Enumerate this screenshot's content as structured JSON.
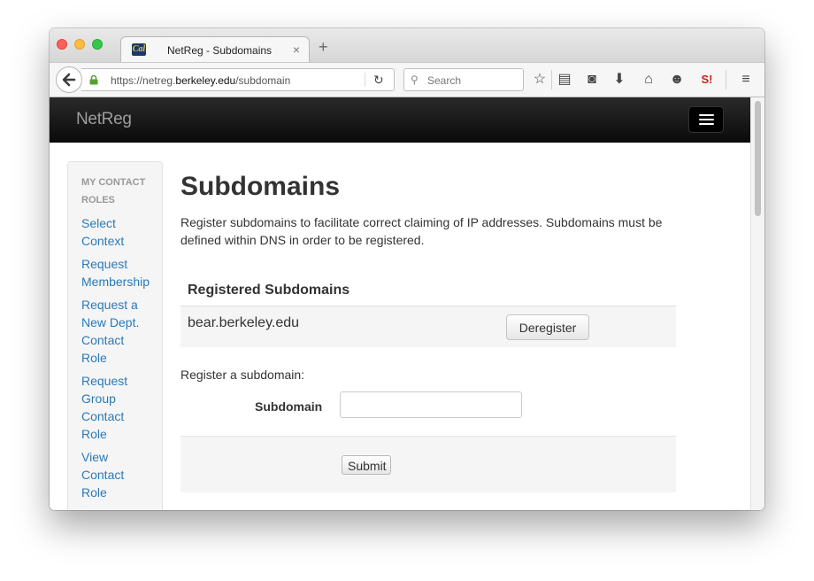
{
  "browser": {
    "tab_title": "NetReg - Subdomains",
    "tab_close": "×",
    "new_tab": "+",
    "favicon_text": "Cal",
    "url_prefix": "https://netreg.",
    "url_domain": "berkeley.edu",
    "url_path": "/subdomain",
    "search_placeholder": "Search"
  },
  "navbar": {
    "brand": "NetReg"
  },
  "sidebar": {
    "header": "MY CONTACT ROLES",
    "items": [
      {
        "label": "Select Context"
      },
      {
        "label": "Request Membership"
      },
      {
        "label": "Request a New Dept. Contact Role"
      },
      {
        "label": "Request Group Contact Role"
      },
      {
        "label": "View Contact Role"
      }
    ]
  },
  "main": {
    "title": "Subdomains",
    "intro": "Register subdomains to facilitate correct claiming of IP addresses. Subdomains must be defined within DNS in order to be registered.",
    "table_header": "Registered Subdomains",
    "rows": [
      {
        "domain": "bear.berkeley.edu",
        "action": "Deregister"
      }
    ],
    "register_label": "Register a subdomain:",
    "field_label": "Subdomain",
    "field_value": "",
    "submit_label": "Submit"
  }
}
